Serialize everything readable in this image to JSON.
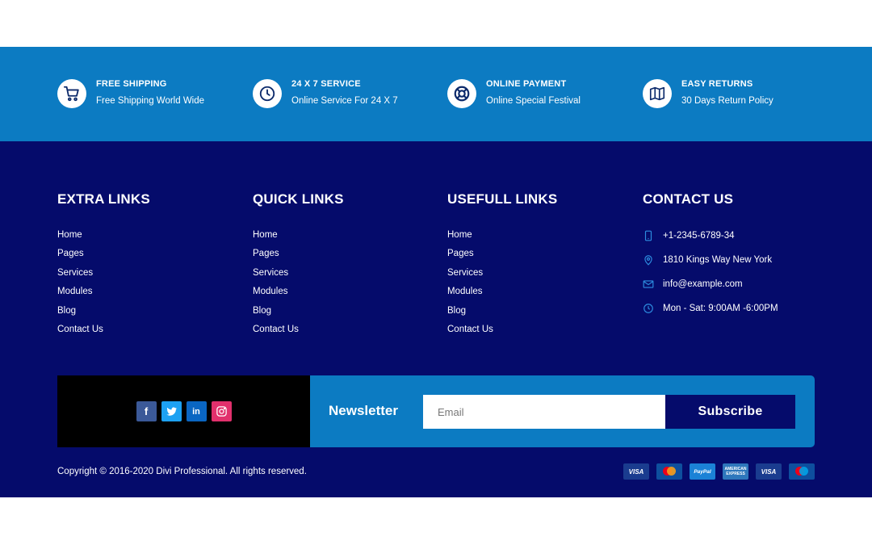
{
  "features": [
    {
      "title": "FREE SHIPPING",
      "subtitle": "Free Shipping World Wide",
      "icon": "cart-icon"
    },
    {
      "title": "24 X 7 SERVICE",
      "subtitle": "Online Service For 24 X 7",
      "icon": "clock-icon"
    },
    {
      "title": "ONLINE PAYMENT",
      "subtitle": "Online Special Festival",
      "icon": "lifebuoy-icon"
    },
    {
      "title": "EASY RETURNS",
      "subtitle": "30 Days Return Policy",
      "icon": "map-icon"
    }
  ],
  "columns": [
    {
      "title": "EXTRA LINKS",
      "links": [
        "Home",
        "Pages",
        "Services",
        "Modules",
        "Blog",
        "Contact Us"
      ]
    },
    {
      "title": "QUICK LINKS",
      "links": [
        "Home",
        "Pages",
        "Services",
        "Modules",
        "Blog",
        "Contact Us"
      ]
    },
    {
      "title": "USEFULL LINKS",
      "links": [
        "Home",
        "Pages",
        "Services",
        "Modules",
        "Blog",
        "Contact Us"
      ]
    }
  ],
  "contact": {
    "title": "CONTACT US",
    "phone": "+1-2345-6789-34",
    "address": "1810 Kings Way New York",
    "email": "info@example.com",
    "hours": "Mon - Sat: 9:00AM -6:00PM"
  },
  "social": [
    {
      "name": "facebook",
      "glyph": "f"
    },
    {
      "name": "twitter",
      "glyph": ""
    },
    {
      "name": "linkedin",
      "glyph": "in"
    },
    {
      "name": "instagram",
      "glyph": ""
    }
  ],
  "newsletter": {
    "label": "Newsletter",
    "email_placeholder": "Email",
    "email_value": "",
    "button_label": "Subscribe"
  },
  "copyright": "Copyright © 2016-2020 Divi Professional. All rights reserved.",
  "payments": [
    {
      "name": "visa",
      "label": "VISA"
    },
    {
      "name": "mastercard",
      "label": ""
    },
    {
      "name": "paypal",
      "label": "PayPal"
    },
    {
      "name": "amex",
      "label": "AMERICAN EXPRESS"
    },
    {
      "name": "visa",
      "label": "VISA"
    },
    {
      "name": "maestro",
      "label": ""
    }
  ],
  "colors": {
    "feature_bar": "#0c7bc2",
    "footer_bg": "#050b6b",
    "social_box": "#000000",
    "newsletter_box": "#0c7bc2",
    "text": "#ffffff"
  }
}
